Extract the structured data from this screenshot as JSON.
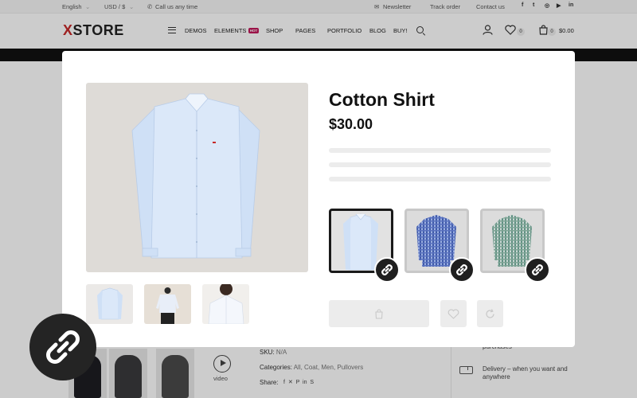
{
  "topbar": {
    "language": "English",
    "currency": "USD / $",
    "phone": "Call us any time",
    "newsletter": "Newsletter",
    "track_order": "Track order",
    "contact": "Contact us",
    "social_icons": [
      "facebook-icon",
      "twitter-icon",
      "instagram-icon",
      "youtube-icon",
      "linkedin-icon"
    ]
  },
  "header": {
    "logo_x": "X",
    "logo_rest": "STORE",
    "nav": [
      "DEMOS",
      "ELEMENTS",
      "SHOP",
      "PAGES",
      "PORTFOLIO",
      "BLOG",
      "BUY!"
    ],
    "nav_badge": "HOT",
    "wishlist_count": "0",
    "cart_count": "0",
    "cart_total": "$0.00"
  },
  "modal": {
    "title": "Cotton Shirt",
    "price": "$30.00",
    "thumbnails": [
      "front-view",
      "back-view",
      "model-view"
    ],
    "variants": [
      "light-blue",
      "navy-check",
      "green-check"
    ],
    "selected_variant": 0
  },
  "page": {
    "video_label": "video",
    "sku_label": "SKU:",
    "sku_value": "N/A",
    "categories_label": "Categories:",
    "categories": "All, Coat, Men, Pullovers",
    "share_label": "Share:",
    "side_purchases": "purchases",
    "side_delivery": "Delivery – when you want and anywhere"
  },
  "colors": {
    "accent": "#c62828",
    "badge": "#c2185b",
    "dark": "#1f1f1f",
    "overlay": "rgba(0,0,0,0.2)"
  }
}
